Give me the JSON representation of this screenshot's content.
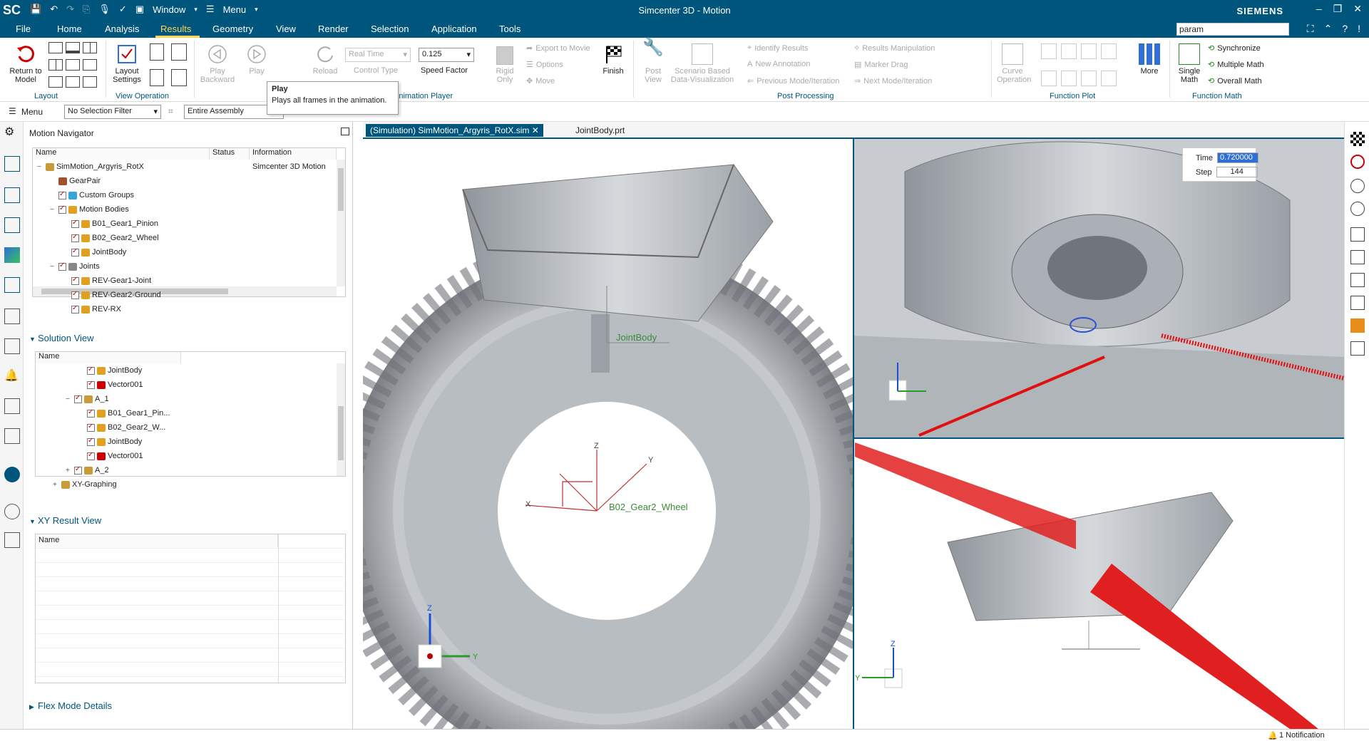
{
  "app": {
    "logo": "SC",
    "title": "Simcenter 3D - Motion",
    "brand": "SIEMENS",
    "window_menu": "Window",
    "menu_menu": "Menu",
    "search_value": "param"
  },
  "menubar": {
    "tabs": [
      "File",
      "Home",
      "Analysis",
      "Results",
      "Geometry",
      "View",
      "Render",
      "Selection",
      "Application",
      "Tools"
    ],
    "active": "Results"
  },
  "ribbon": {
    "return_to_model": "Return to Model",
    "layout_group": "Layout",
    "layout_settings": "Layout Settings",
    "view_operation_group": "View Operation",
    "play_backward": "Play Backward",
    "play": "Play",
    "reload": "Reload",
    "control_type_value": "Real Time",
    "control_type_label": "Control Type",
    "speed_value": "0.125",
    "speed_label": "Speed Factor",
    "rigid_only": "Rigid Only",
    "export_to_movie": "Export to Movie",
    "options": "Options",
    "move": "Move",
    "finish": "Finish",
    "animation_player_group": "Animation Player",
    "post_view": "Post View",
    "scenario_based": "Scenario Based Data-Visualization",
    "identify_results": "Identify Results",
    "new_annotation": "New Annotation",
    "previous_mode": "Previous Mode/Iteration",
    "results_manipulation": "Results Manipulation",
    "marker_drag": "Marker Drag",
    "next_mode": "Next Mode/Iteration",
    "post_processing_group": "Post Processing",
    "curve_operation": "Curve Operation",
    "more": "More",
    "function_plot_group": "Function Plot",
    "single_math": "Single Math",
    "synchronize": "Synchronize",
    "multiple_math": "Multiple Math",
    "overall_math": "Overall Math",
    "function_math_group": "Function Math"
  },
  "tooltip": {
    "title": "Play",
    "text": "Plays all frames in the animation."
  },
  "toolbar2": {
    "menu": "Menu",
    "selection_filter": "No Selection Filter",
    "scope": "Entire Assembly"
  },
  "navigator": {
    "title": "Motion Navigator",
    "columns": [
      "Name",
      "Status",
      "Information"
    ],
    "rows": [
      {
        "label": "SimMotion_Argyris_RotX",
        "info": "Simcenter 3D Motion",
        "indent": 0,
        "expander": "−",
        "check": false,
        "icon": "#c89a3a"
      },
      {
        "label": "GearPair",
        "info": "",
        "indent": 1,
        "expander": "",
        "check": false,
        "icon": "#a0522d"
      },
      {
        "label": "Custom Groups",
        "info": "",
        "indent": 1,
        "expander": "",
        "check": true,
        "icon": "#38a5d8"
      },
      {
        "label": "Motion Bodies",
        "info": "",
        "indent": 1,
        "expander": "−",
        "check": true,
        "icon": "#e0a020"
      },
      {
        "label": "B01_Gear1_Pinion",
        "info": "",
        "indent": 2,
        "expander": "",
        "check": true,
        "icon": "#e0a020"
      },
      {
        "label": "B02_Gear2_Wheel",
        "info": "",
        "indent": 2,
        "expander": "",
        "check": true,
        "icon": "#e0a020"
      },
      {
        "label": "JointBody",
        "info": "",
        "indent": 2,
        "expander": "",
        "check": true,
        "icon": "#e0a020"
      },
      {
        "label": "Joints",
        "info": "",
        "indent": 1,
        "expander": "−",
        "check": true,
        "icon": "#888"
      },
      {
        "label": "REV-Gear1-Joint",
        "info": "",
        "indent": 2,
        "expander": "",
        "check": true,
        "icon": "#e0a020"
      },
      {
        "label": "REV-Gear2-Ground",
        "info": "",
        "indent": 2,
        "expander": "",
        "check": true,
        "icon": "#e0a020"
      },
      {
        "label": "REV-RX",
        "info": "",
        "indent": 2,
        "expander": "",
        "check": true,
        "icon": "#e0a020"
      }
    ]
  },
  "solution_view": {
    "title": "Solution View",
    "column": "Name",
    "rows": [
      {
        "label": "JointBody",
        "indent": 3,
        "expander": "",
        "icon": "#e0a020"
      },
      {
        "label": "Vector001",
        "indent": 3,
        "expander": "",
        "icon": "#c00"
      },
      {
        "label": "A_1",
        "indent": 2,
        "expander": "−",
        "icon": "#c89a3a"
      },
      {
        "label": "B01_Gear1_Pin...",
        "indent": 3,
        "expander": "",
        "icon": "#e0a020"
      },
      {
        "label": "B02_Gear2_W...",
        "indent": 3,
        "expander": "",
        "icon": "#e0a020"
      },
      {
        "label": "JointBody",
        "indent": 3,
        "expander": "",
        "icon": "#e0a020"
      },
      {
        "label": "Vector001",
        "indent": 3,
        "expander": "",
        "icon": "#c00"
      },
      {
        "label": "A_2",
        "indent": 2,
        "expander": "+",
        "icon": "#c89a3a"
      },
      {
        "label": "XY-Graphing",
        "indent": 1,
        "expander": "+",
        "icon": "#c89a3a"
      }
    ]
  },
  "xy_result_view": {
    "title": "XY Result View",
    "column": "Name"
  },
  "flex_mode": {
    "title": "Flex Mode Details"
  },
  "viewport": {
    "tab1": "(Simulation) SimMotion_Argyris_RotX.sim",
    "tab2": "JointBody.prt",
    "time_label": "Time",
    "time_value": "0.720000",
    "step_label": "Step",
    "step_value": "144",
    "label_wheel": "B02_Gear2_Wheel",
    "label_joint": "JointBody",
    "axis_x": "X",
    "axis_y": "Y",
    "axis_z": "Z"
  },
  "status": {
    "notification": "1 Notification"
  }
}
